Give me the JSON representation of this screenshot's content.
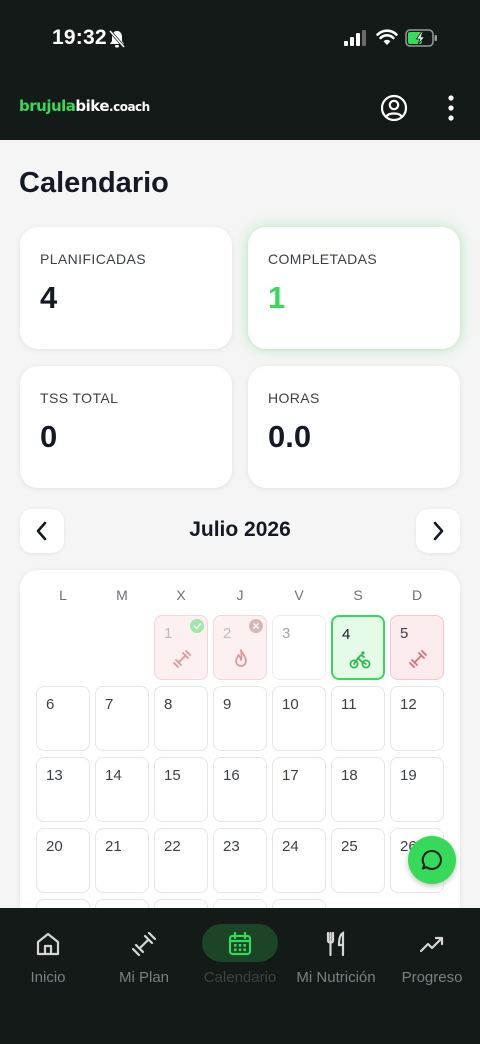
{
  "status_bar": {
    "time": "19:32",
    "icons": [
      "bell-off-icon",
      "signal-icon",
      "wifi-icon",
      "battery-charging-icon"
    ]
  },
  "header": {
    "brand_part1": "brujula",
    "brand_part2": "bike",
    "brand_part3": ".coach",
    "icons": [
      "profile-icon",
      "more-vertical-icon"
    ]
  },
  "page": {
    "title": "Calendario"
  },
  "stats": {
    "planned_label": "PLANIFICADAS",
    "planned_value": "4",
    "completed_label": "COMPLETADAS",
    "completed_value": "1",
    "tss_label": "TSS TOTAL",
    "tss_value": "0",
    "hours_label": "HORAS",
    "hours_value": "0.0"
  },
  "calendar": {
    "month": "Julio 2026",
    "weekdays": [
      "L",
      "M",
      "X",
      "J",
      "V",
      "S",
      "D"
    ],
    "days": {
      "d1": "1",
      "d2": "2",
      "d3": "3",
      "d4": "4",
      "d5": "5",
      "d6": "6",
      "d7": "7",
      "d8": "8",
      "d9": "9",
      "d10": "10",
      "d11": "11",
      "d12": "12",
      "d13": "13",
      "d14": "14",
      "d15": "15",
      "d16": "16",
      "d17": "17",
      "d18": "18",
      "d19": "19",
      "d20": "20",
      "d21": "21",
      "d22": "22",
      "d23": "23",
      "d24": "24",
      "d25": "25",
      "d26": "26"
    },
    "workout_icons": {
      "d1": "dumbbell-icon",
      "d2": "flame-icon",
      "d4": "bike-icon",
      "d5": "dumbbell-icon"
    },
    "badges": {
      "d1": "check-badge-icon",
      "d2": "cross-badge-icon"
    }
  },
  "nav": {
    "inicio": "Inicio",
    "plan": "Mi Plan",
    "calendario": "Calendario",
    "nutricion": "Mi Nutrición",
    "progreso": "Progreso"
  },
  "colors": {
    "accent": "#36d958",
    "dark": "#141a17",
    "missed_bg": "#fcebed",
    "missed_icon": "#d9707a"
  }
}
